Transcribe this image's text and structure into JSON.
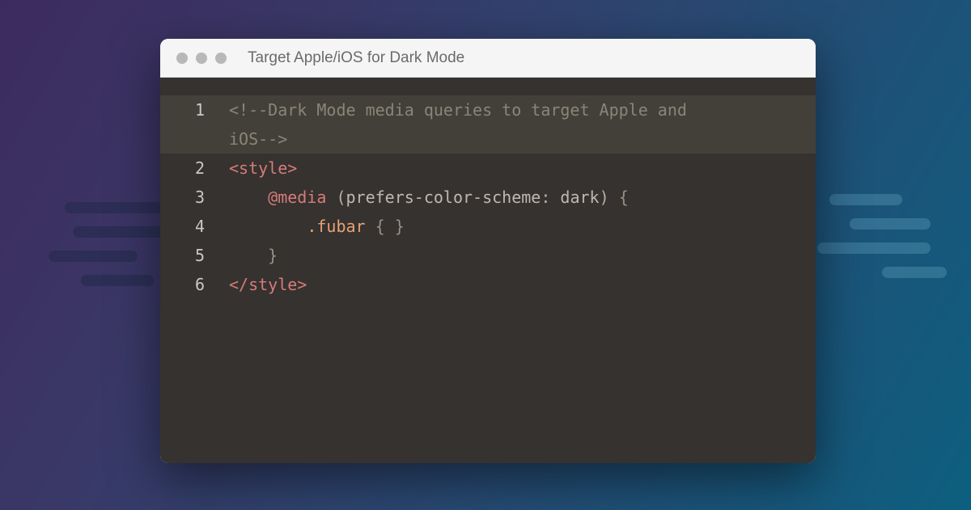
{
  "window": {
    "title": "Target Apple/iOS for Dark Mode"
  },
  "code": {
    "lines": [
      {
        "n": "1",
        "tokens": [
          {
            "t": "<!--Dark Mode media queries to target Apple and",
            "c": "comment"
          }
        ]
      },
      {
        "n": "",
        "tokens": [
          {
            "t": "iOS-->",
            "c": "comment"
          }
        ]
      },
      {
        "n": "2",
        "tokens": [
          {
            "t": "<style>",
            "c": "tag"
          }
        ]
      },
      {
        "n": "3",
        "tokens": [
          {
            "t": "    ",
            "c": "plain"
          },
          {
            "t": "@media",
            "c": "keyword"
          },
          {
            "t": " ",
            "c": "plain"
          },
          {
            "t": "(",
            "c": "paren"
          },
          {
            "t": "prefers-color-scheme",
            "c": "prop"
          },
          {
            "t": ":",
            "c": "paren"
          },
          {
            "t": " dark",
            "c": "value"
          },
          {
            "t": ")",
            "c": "paren"
          },
          {
            "t": " {",
            "c": "brace"
          }
        ]
      },
      {
        "n": "4",
        "tokens": [
          {
            "t": "        ",
            "c": "plain"
          },
          {
            "t": ".fubar",
            "c": "selector"
          },
          {
            "t": " { }",
            "c": "brace"
          }
        ]
      },
      {
        "n": "5",
        "tokens": [
          {
            "t": "    ",
            "c": "plain"
          },
          {
            "t": "}",
            "c": "brace"
          }
        ]
      },
      {
        "n": "6",
        "tokens": [
          {
            "t": "</style>",
            "c": "tag"
          }
        ]
      }
    ]
  },
  "colors": {
    "bg_gradient_start": "#3d2b5f",
    "bg_gradient_end": "#0d5f7f",
    "editor_bg": "#353230",
    "titlebar_bg": "#f5f5f5",
    "comment": "#8a8578",
    "tag": "#d67b78",
    "selector": "#e8a272"
  }
}
